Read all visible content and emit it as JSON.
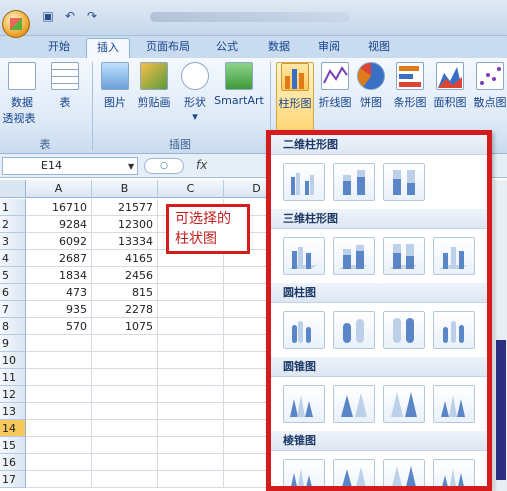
{
  "quick_access": {
    "icons": [
      "save-icon",
      "undo-icon",
      "redo-icon"
    ]
  },
  "tabs": [
    "开始",
    "插入",
    "页面布局",
    "公式",
    "数据",
    "审阅",
    "视图"
  ],
  "active_tab": "插入",
  "ribbon": {
    "groups": [
      {
        "label": "表",
        "buttons": [
          {
            "label": "数据",
            "sub": "透视表"
          },
          {
            "label": "表"
          }
        ]
      },
      {
        "label": "插图",
        "buttons": [
          {
            "label": "图片"
          },
          {
            "label": "剪贴画"
          },
          {
            "label": "形状"
          },
          {
            "label": "SmartArt"
          }
        ]
      },
      {
        "label": "",
        "buttons": [
          {
            "label": "柱形图"
          },
          {
            "label": "折线图"
          },
          {
            "label": "饼图"
          },
          {
            "label": "条形图"
          },
          {
            "label": "面积图"
          },
          {
            "label": "散点图"
          }
        ]
      }
    ]
  },
  "formula_bar": {
    "name_box": "E14",
    "fx": "fx"
  },
  "columns": [
    "A",
    "B",
    "C",
    "D"
  ],
  "rows": [
    {
      "n": "1",
      "a": "16710",
      "b": "21577"
    },
    {
      "n": "2",
      "a": "9284",
      "b": "12300"
    },
    {
      "n": "3",
      "a": "6092",
      "b": "13334"
    },
    {
      "n": "4",
      "a": "2687",
      "b": "4165"
    },
    {
      "n": "5",
      "a": "1834",
      "b": "2456"
    },
    {
      "n": "6",
      "a": "473",
      "b": "815"
    },
    {
      "n": "7",
      "a": "935",
      "b": "2278"
    },
    {
      "n": "8",
      "a": "570",
      "b": "1075"
    },
    {
      "n": "9",
      "a": "",
      "b": ""
    },
    {
      "n": "10",
      "a": "",
      "b": ""
    },
    {
      "n": "11",
      "a": "",
      "b": ""
    },
    {
      "n": "12",
      "a": "",
      "b": ""
    },
    {
      "n": "13",
      "a": "",
      "b": ""
    },
    {
      "n": "14",
      "a": "",
      "b": ""
    },
    {
      "n": "15",
      "a": "",
      "b": ""
    },
    {
      "n": "16",
      "a": "",
      "b": ""
    },
    {
      "n": "17",
      "a": "",
      "b": ""
    }
  ],
  "selected_row": "14",
  "callout": {
    "line1": "可选择的",
    "line2": "柱状图"
  },
  "gallery": {
    "sections": [
      "二维柱形图",
      "三维柱形图",
      "圆柱图",
      "圆锥图",
      "棱锥图"
    ]
  },
  "colors": {
    "highlight_red": "#d41c1c",
    "ribbon_blue": "#c9dbef"
  }
}
